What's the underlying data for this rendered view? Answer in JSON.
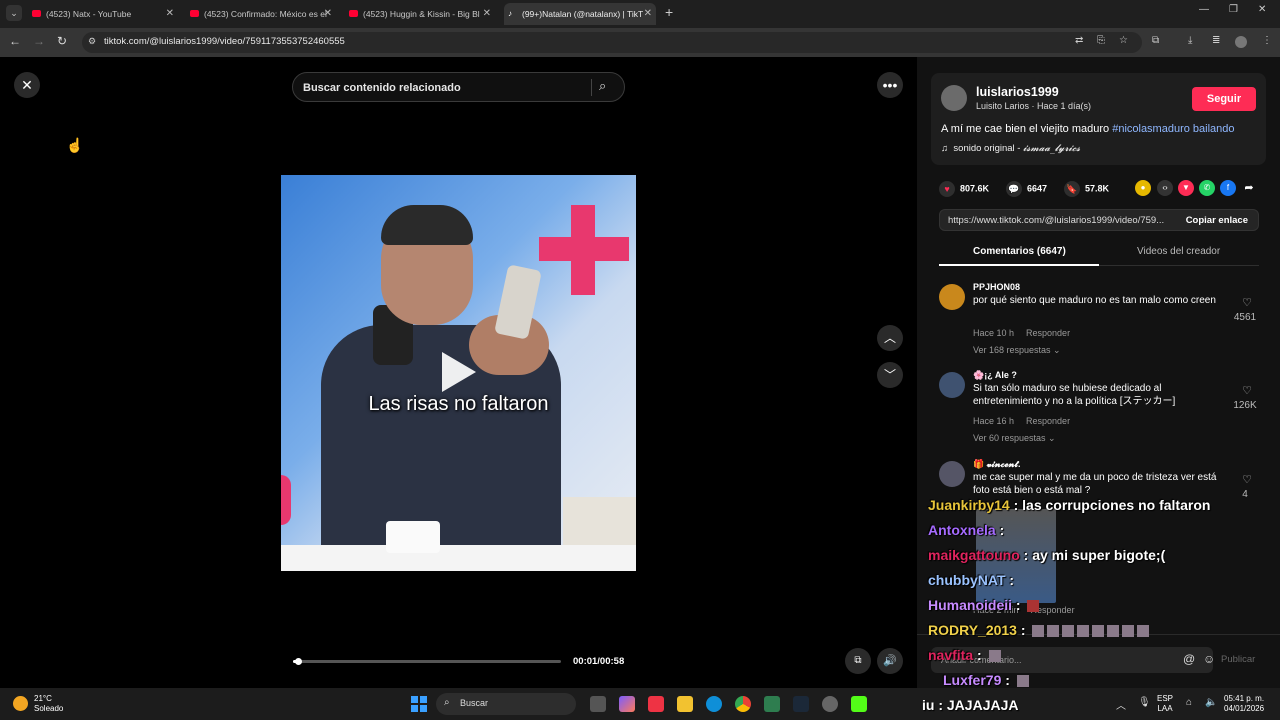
{
  "browser": {
    "tabs": [
      {
        "title": "(4523) Natx - YouTube",
        "kind": "youtube"
      },
      {
        "title": "(4523) Confirmado: México es el",
        "kind": "youtube"
      },
      {
        "title": "(4523) Huggin & Kissin - Big Bl",
        "kind": "youtube"
      },
      {
        "title": "(99+)Natalan (@natalanx) | TikT",
        "kind": "tiktok"
      }
    ],
    "url": "tiktok.com/@luislarios1999/video/7591173553752460555"
  },
  "page": {
    "search_placeholder": "Buscar contenido relacionado",
    "video_caption": "Las risas no faltaron",
    "timecode": "00:01/00:58",
    "progress": 0.02
  },
  "post": {
    "username": "luislarios1999",
    "subtitle": "Luisito Larios · Hace 1 día(s)",
    "follow_label": "Seguir",
    "description": "A mí me cae bien el viejito maduro ",
    "hashtag": "#nicolasmaduro bailando",
    "sound_prefix": "sonido original - ",
    "sound_name": "𝓲𝓼𝓶𝓪𝓪_𝓵𝔂𝓻𝓲𝓬𝓼",
    "likes": "807.6K",
    "comments": "6647",
    "saves": "57.8K",
    "link": "https://www.tiktok.com/@luislarios1999/video/759...",
    "copy_label": "Copiar enlace",
    "tab_comments": "Comentarios (6647)",
    "tab_videos": "Videos del creador"
  },
  "comments": [
    {
      "user": "PPJHON08",
      "text": "por qué siento que maduro no es tan malo como creen",
      "time": "Hace 10 h",
      "reply": "Responder",
      "replies": "Ver 168 respuestas ⌄",
      "likes": "4561"
    },
    {
      "user": "🌸¡¿ Ale ?",
      "text": "Si tan sólo maduro se hubiese dedicado al entretenimiento y no a la política [ステッカー]",
      "time": "Hace 16 h",
      "reply": "Responder",
      "replies": "Ver 60 respuestas ⌄",
      "likes": "126K"
    },
    {
      "user": "🎁 𝓿𝓲𝓷𝓬𝓮𝓷𝓽.",
      "text": "me cae super mal y me da un poco de tristeza ver está foto está bien o está mal ?",
      "time": "Hace 2 min",
      "reply": "Responder",
      "likes": "4"
    }
  ],
  "comment_bar": {
    "placeholder": "Añadir comentario...",
    "publish": "Publicar"
  },
  "chat": [
    {
      "user": "Juankirby14",
      "color": "#e8c53a",
      "msg": " : las corrupciones no faltaron"
    },
    {
      "user": "Antoxnela",
      "color": "#a66bff",
      "msg": " : "
    },
    {
      "user": "maikgattouno",
      "color": "#e0245e",
      "msg": " : ay mi super bigote;("
    },
    {
      "user": "chubbyNAT",
      "color": "#9bc3ff",
      "msg": " : "
    },
    {
      "user": "Humanoideii",
      "color": "#c78bff",
      "msg": " : "
    },
    {
      "user": "RODRY_2013",
      "color": "#f0d14a",
      "msg": " : "
    },
    {
      "user": "navfita",
      "color": "#e0245e",
      "msg": " : "
    },
    {
      "user": "Luxfer79",
      "color": "#c78bff",
      "msg": " : "
    },
    {
      "user": "iu",
      "color": "#ffffff",
      "msg": " : JAJAJAJA"
    }
  ],
  "taskbar": {
    "temp": "21°C",
    "weather": "Soleado",
    "search": "Buscar",
    "lang1": "ESP",
    "lang2": "LAA",
    "time": "05:41 p. m.",
    "date": "04/01/2026"
  },
  "colors": {
    "follow": "#fe2c55",
    "hashtag": "#8fb7ff",
    "taskbar": "#1c1c1c"
  }
}
